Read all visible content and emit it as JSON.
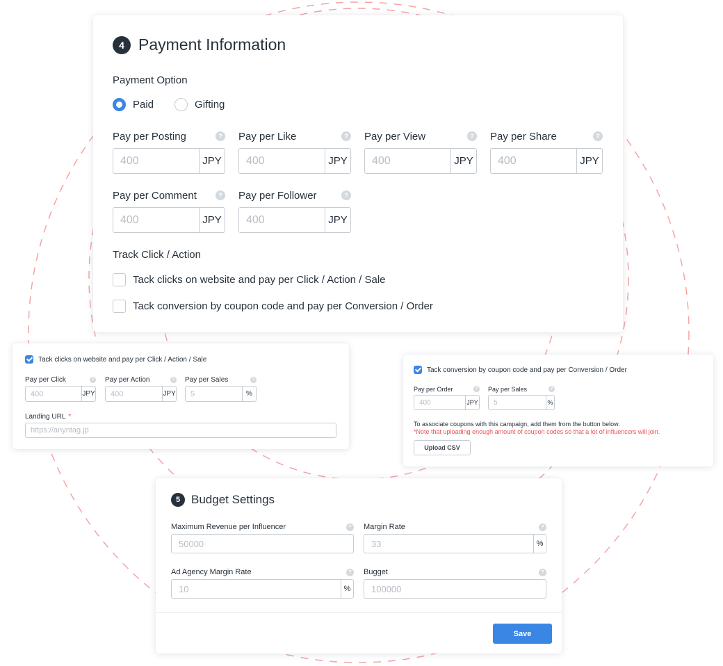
{
  "colors": {
    "accent": "#3a86e5",
    "ring": "#f5a3a3",
    "error": "#e95151",
    "badge": "#27313b"
  },
  "payment": {
    "step": "4",
    "title": "Payment Information",
    "option_label": "Payment Option",
    "options": [
      {
        "label": "Paid",
        "selected": true
      },
      {
        "label": "Gifting",
        "selected": false
      }
    ],
    "fields": [
      {
        "label": "Pay per Posting",
        "placeholder": "400",
        "unit": "JPY"
      },
      {
        "label": "Pay per Like",
        "placeholder": "400",
        "unit": "JPY"
      },
      {
        "label": "Pay per View",
        "placeholder": "400",
        "unit": "JPY"
      },
      {
        "label": "Pay per Share",
        "placeholder": "400",
        "unit": "JPY"
      },
      {
        "label": "Pay per Comment",
        "placeholder": "400",
        "unit": "JPY"
      },
      {
        "label": "Pay per Follower",
        "placeholder": "400",
        "unit": "JPY"
      }
    ],
    "track_label": "Track Click / Action",
    "track_options": [
      {
        "label": "Tack clicks on website and pay per Click / Action / Sale",
        "checked": false
      },
      {
        "label": "Tack conversion by coupon code and pay per Conversion / Order",
        "checked": false
      }
    ]
  },
  "click_card": {
    "check_label": "Tack clicks on website and pay per Click / Action / Sale",
    "checked": true,
    "fields": [
      {
        "label": "Pay per Click",
        "placeholder": "400",
        "unit": "JPY"
      },
      {
        "label": "Pay per Action",
        "placeholder": "400",
        "unit": "JPY"
      },
      {
        "label": "Pay per Sales",
        "placeholder": "5",
        "unit": "%"
      }
    ],
    "url_label": "Landing URL",
    "required_mark": "*",
    "url_placeholder": "https://anyntag.jp"
  },
  "coupon_card": {
    "check_label": "Tack conversion by coupon code and pay per Conversion / Order",
    "checked": true,
    "fields": [
      {
        "label": "Pay per Order",
        "placeholder": "400",
        "unit": "JPY"
      },
      {
        "label": "Pay per Sales",
        "placeholder": "5",
        "unit": "%"
      }
    ],
    "note": "To associate coupons with this campaign, add them from the button below.",
    "warning": "*Note that uploading enough amount of coupon codes so that a lot of influencers will join.",
    "upload_label": "Upload CSV"
  },
  "budget": {
    "step": "5",
    "title": "Budget Settings",
    "fields": [
      {
        "label": "Maximum Revenue per Influencer",
        "placeholder": "50000",
        "unit": ""
      },
      {
        "label": "Margin Rate",
        "placeholder": "33",
        "unit": "%"
      },
      {
        "label": "Ad Agency Margin Rate",
        "placeholder": "10",
        "unit": "%"
      },
      {
        "label": "Bugget",
        "placeholder": "100000",
        "unit": ""
      }
    ],
    "save_label": "Save"
  },
  "icons": {
    "help": "question-circle-icon",
    "check": "checkmark-icon"
  }
}
